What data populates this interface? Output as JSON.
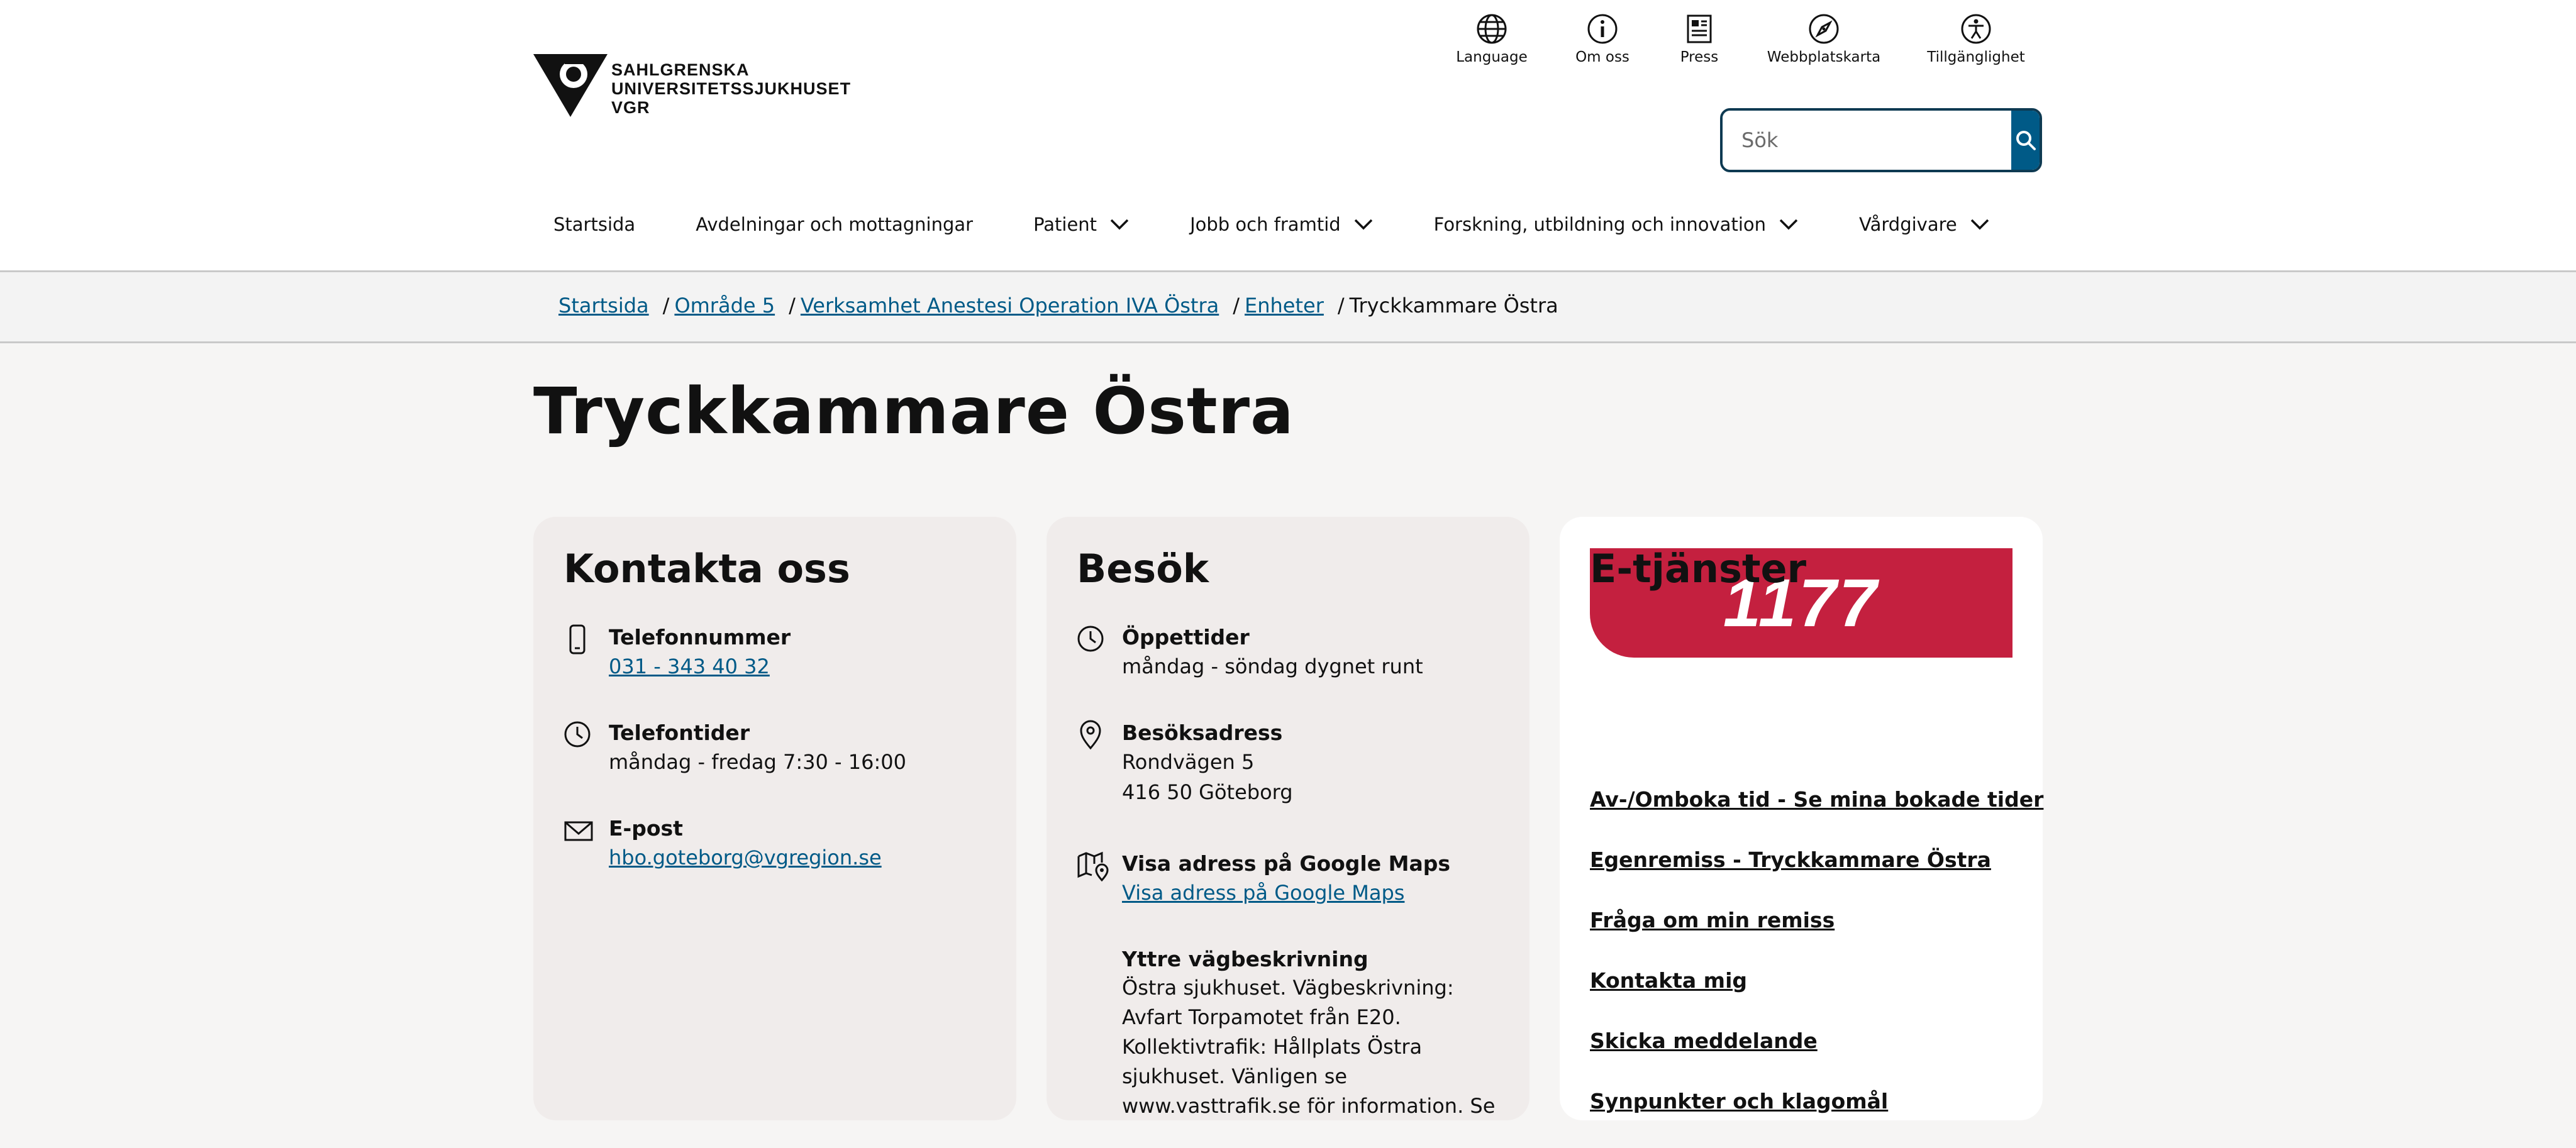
{
  "logo": {
    "lines": [
      "SAHLGRENSKA",
      "UNIVERSITETSSJUKHUSET",
      "VGR"
    ]
  },
  "utility_nav": [
    {
      "label": "Language",
      "icon": "globe-icon"
    },
    {
      "label": "Om oss",
      "icon": "info-icon"
    },
    {
      "label": "Press",
      "icon": "newspaper-icon"
    },
    {
      "label": "Webbplatskarta",
      "icon": "compass-icon"
    },
    {
      "label": "Tillgänglighet",
      "icon": "accessibility-icon"
    }
  ],
  "search": {
    "placeholder": "Sök",
    "button_icon": "search-icon"
  },
  "main_nav": [
    {
      "label": "Startsida",
      "has_dropdown": false
    },
    {
      "label": "Avdelningar och mottagningar",
      "has_dropdown": false
    },
    {
      "label": "Patient",
      "has_dropdown": true
    },
    {
      "label": "Jobb och framtid",
      "has_dropdown": true
    },
    {
      "label": "Forskning, utbildning och innovation",
      "has_dropdown": true
    },
    {
      "label": "Vårdgivare",
      "has_dropdown": true
    }
  ],
  "breadcrumb": {
    "links": [
      "Startsida",
      "Område 5",
      "Verksamhet Anestesi Operation IVA Östra",
      "Enheter"
    ],
    "current": "Tryckkammare Östra",
    "separator": "/"
  },
  "page_title": "Tryckkammare Östra",
  "contact": {
    "title": "Kontakta oss",
    "phone": {
      "label": "Telefonnummer",
      "value": "031 - 343 40 32"
    },
    "phone_hours": {
      "label": "Telefontider",
      "value": "måndag - fredag 7:30 - 16:00"
    },
    "email": {
      "label": "E-post",
      "value": "hbo.goteborg@vgregion.se"
    }
  },
  "visit": {
    "title": "Besök",
    "hours": {
      "label": "Öppettider",
      "value": "måndag - söndag dygnet runt"
    },
    "address": {
      "label": "Besöksadress",
      "line1": "Rondvägen 5",
      "line2": "416 50 Göteborg"
    },
    "maps": {
      "label": "Visa adress på Google Maps",
      "link": "Visa adress på Google Maps"
    },
    "directions": {
      "label": "Yttre vägbeskrivning",
      "text": "Östra sjukhuset. Vägbeskrivning: Avfart Torpamotet från E20. Kollektivtrafik: Hållplats Östra sjukhuset. Vänligen se www.vasttrafik.se för information. Se"
    }
  },
  "eservices": {
    "banner": "1177",
    "title": "E-tjänster",
    "links": [
      "Av-/Omboka tid - Se mina bokade tider",
      "Egenremiss - Tryckkammare Östra",
      "Fråga om min remiss",
      "Kontakta mig",
      "Skicka meddelande",
      "Synpunkter och klagomål"
    ]
  },
  "colors": {
    "link": "#005a87",
    "search_button": "#005a87",
    "brand_1177": "#c4203f",
    "card_grey": "#f0eceb",
    "page_bg": "#f6f5f4"
  }
}
